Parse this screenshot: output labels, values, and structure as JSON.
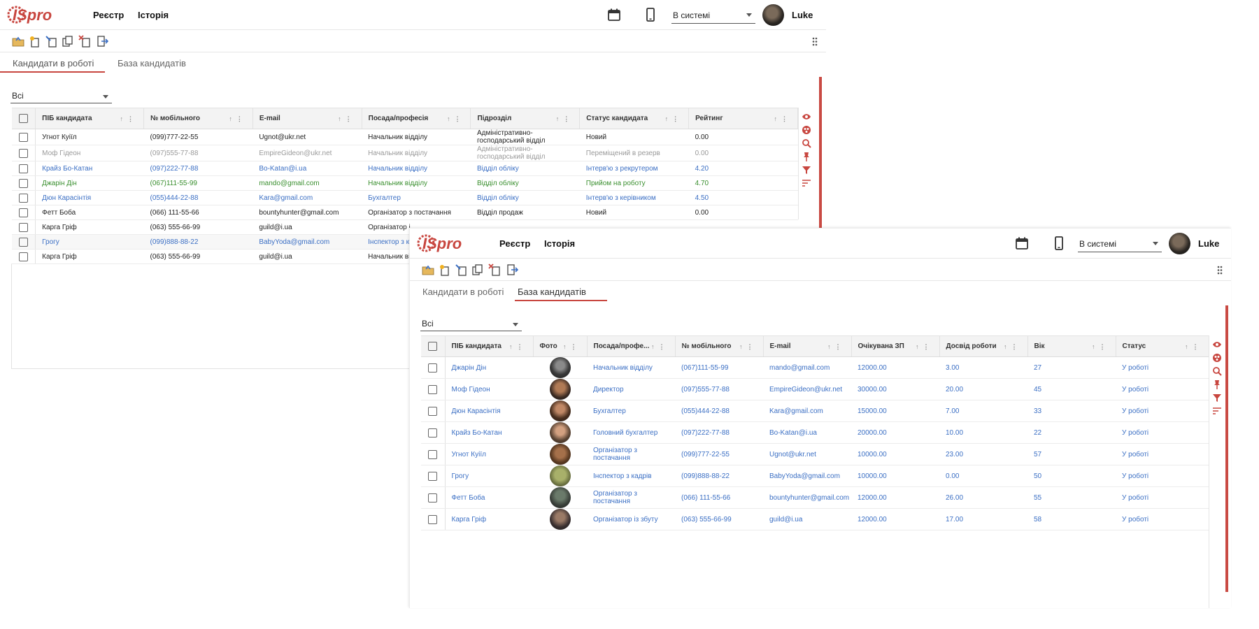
{
  "app": {
    "logo_text": "ISpro",
    "menu": [
      "Реєстр",
      "Історія"
    ],
    "status_value": "В системі",
    "user_name": "Luke",
    "accent": "#c8463f"
  },
  "toolbar_icons": [
    "open-folder-icon",
    "add-record-icon",
    "edit-record-icon",
    "copy-icon",
    "delete-icon",
    "exit-icon"
  ],
  "side_icons": [
    "view-eye-icon",
    "group-icon",
    "search-icon",
    "pin-icon",
    "filter-icon",
    "sort-icon"
  ],
  "window1": {
    "tabs": [
      "Кандидати в роботі",
      "База кандидатів"
    ],
    "active_tab": 0,
    "filter_value": "Всі",
    "columns": [
      "ПІБ кандидата",
      "№ мобільного",
      "E-mail",
      "Посада/професія",
      "Підрозділ",
      "Статус кандидата",
      "Рейтинг"
    ],
    "rows": [
      {
        "name": "Угнот Куіїл",
        "phone": "(099)777-22-55",
        "email": "Ugnot@ukr.net",
        "position": "Начальник відділу",
        "dept": "Адміністративно-господарський відділ",
        "status": "Новий",
        "rating": "0.00",
        "color": "black"
      },
      {
        "name": "Моф Гідеон",
        "phone": "(097)555-77-88",
        "email": "EmpireGideon@ukr.net",
        "position": "Начальник відділу",
        "dept": "Адміністративно-господарський відділ",
        "status": "Переміщений в резерв",
        "rating": "0.00",
        "color": "gray"
      },
      {
        "name": "Крайз Бо-Катан",
        "phone": "(097)222-77-88",
        "email": "Bo-Katan@i.ua",
        "position": "Начальник відділу",
        "dept": "Відділ обліку",
        "status": "Інтерв'ю з рекрутером",
        "rating": "4.20",
        "color": "blue"
      },
      {
        "name": "Джарін Дін",
        "phone": "(067)111-55-99",
        "email": "mando@gmail.com",
        "position": "Начальник відділу",
        "dept": "Відділ обліку",
        "status": "Прийом на роботу",
        "rating": "4.70",
        "color": "green"
      },
      {
        "name": "Дюн Карасінтія",
        "phone": "(055)444-22-88",
        "email": "Kara@gmail.com",
        "position": "Бухгалтер",
        "dept": "Відділ обліку",
        "status": "Інтерв'ю з керівником",
        "rating": "4.50",
        "color": "blue"
      },
      {
        "name": "Фетт Боба",
        "phone": "(066) 111-55-66",
        "email": "bountyhunter@gmail.com",
        "position": "Організатор з постачання",
        "dept": "Відділ продаж",
        "status": "Новий",
        "rating": "0.00",
        "color": "black"
      },
      {
        "name": "Карга Гріф",
        "phone": "(063) 555-66-99",
        "email": "guild@i.ua",
        "position": "Організатор і",
        "dept": "",
        "status": "",
        "rating": "",
        "color": "black"
      },
      {
        "name": "Грогу",
        "phone": "(099)888-88-22",
        "email": "BabyYoda@gmail.com",
        "position": "Інспектор з к",
        "dept": "",
        "status": "",
        "rating": "",
        "color": "blue"
      },
      {
        "name": "Карга Гріф",
        "phone": "(063) 555-66-99",
        "email": "guild@i.ua",
        "position": "Начальник ві",
        "dept": "",
        "status": "",
        "rating": "",
        "color": "black"
      }
    ]
  },
  "window2": {
    "tabs": [
      "Кандидати в роботі",
      "База кандидатів"
    ],
    "active_tab": 1,
    "filter_value": "Всі",
    "columns": [
      "ПІБ кандидата",
      "Фото",
      "Посада/профе...",
      "№ мобільного",
      "E-mail",
      "Очікувана ЗП",
      "Досвід роботи",
      "Вік",
      "Статус"
    ],
    "rows": [
      {
        "name": "Джарін Дін",
        "photo": "helmet",
        "position": "Начальник відділу",
        "phone": "(067)111-55-99",
        "email": "mando@gmail.com",
        "salary": "12000.00",
        "experience": "3.00",
        "age": "27",
        "status": "У роботі"
      },
      {
        "name": "Моф Гідеон",
        "photo": "man",
        "position": "Директор",
        "phone": "(097)555-77-88",
        "email": "EmpireGideon@ukr.net",
        "salary": "30000.00",
        "experience": "20.00",
        "age": "45",
        "status": "У роботі"
      },
      {
        "name": "Дюн Карасінтія",
        "photo": "woman",
        "position": "Бухгалтер",
        "phone": "(055)444-22-88",
        "email": "Kara@gmail.com",
        "salary": "15000.00",
        "experience": "7.00",
        "age": "33",
        "status": "У роботі"
      },
      {
        "name": "Крайз Бо-Катан",
        "photo": "woman2",
        "position": "Головний бухгалтер",
        "phone": "(097)222-77-88",
        "email": "Bo-Katan@i.ua",
        "salary": "20000.00",
        "experience": "10.00",
        "age": "22",
        "status": "У роботі"
      },
      {
        "name": "Угнот Куіїл",
        "photo": "alien",
        "position": "Організатор з постачання",
        "phone": "(099)777-22-55",
        "email": "Ugnot@ukr.net",
        "salary": "10000.00",
        "experience": "23.00",
        "age": "57",
        "status": "У роботі"
      },
      {
        "name": "Грогу",
        "photo": "yoda",
        "position": "Інспектор з кадрів",
        "phone": "(099)888-88-22",
        "email": "BabyYoda@gmail.com",
        "salary": "10000.00",
        "experience": "0.00",
        "age": "50",
        "status": "У роботі"
      },
      {
        "name": "Фетт Боба",
        "photo": "helmet2",
        "position": "Організатор з постачання",
        "phone": "(066) 111-55-66",
        "email": "bountyhunter@gmail.com",
        "salary": "12000.00",
        "experience": "26.00",
        "age": "55",
        "status": "У роботі"
      },
      {
        "name": "Карга Гріф",
        "photo": "man2",
        "position": "Організатор із збуту",
        "phone": "(063) 555-66-99",
        "email": "guild@i.ua",
        "salary": "12000.00",
        "experience": "17.00",
        "age": "58",
        "status": "У роботі"
      }
    ]
  }
}
